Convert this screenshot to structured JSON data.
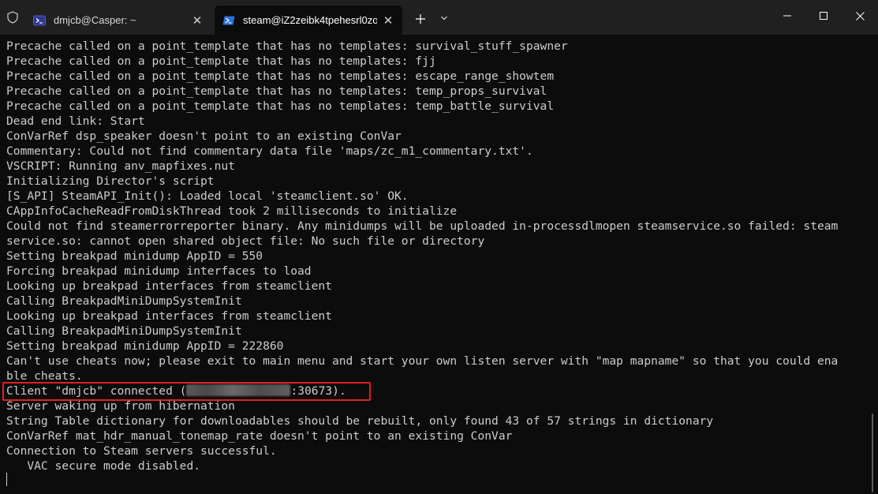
{
  "titlebar": {
    "tabs": [
      {
        "title": "dmjcb@Casper: ~",
        "close": "✕"
      },
      {
        "title": "steam@iZ2zeibk4tpehesrl0zoc",
        "close": "✕"
      }
    ],
    "new_tab": "+"
  },
  "terminal": {
    "lines": [
      "Precache called on a point_template that has no templates: survival_stuff_spawner",
      "Precache called on a point_template that has no templates: fjj",
      "Precache called on a point_template that has no templates: escape_range_showtem",
      "Precache called on a point_template that has no templates: temp_props_survival",
      "Precache called on a point_template that has no templates: temp_battle_survival",
      "Dead end link: Start",
      "ConVarRef dsp_speaker doesn't point to an existing ConVar",
      "Commentary: Could not find commentary data file 'maps/zc_m1_commentary.txt'.",
      "VSCRIPT: Running anv_mapfixes.nut",
      "Initializing Director's script",
      "[S_API] SteamAPI_Init(): Loaded local 'steamclient.so' OK.",
      "CAppInfoCacheReadFromDiskThread took 2 milliseconds to initialize",
      "Could not find steamerrorreporter binary. Any minidumps will be uploaded in-processdlmopen steamservice.so failed: steam",
      "service.so: cannot open shared object file: No such file or directory",
      "Setting breakpad minidump AppID = 550",
      "Forcing breakpad minidump interfaces to load",
      "Looking up breakpad interfaces from steamclient",
      "Calling BreakpadMiniDumpSystemInit",
      "Looking up breakpad interfaces from steamclient",
      "Calling BreakpadMiniDumpSystemInit",
      "Setting breakpad minidump AppID = 222860",
      "Can't use cheats now; please exit to main menu and start your own listen server with \"map mapname\" so that you could ena",
      "ble cheats."
    ],
    "client_line": {
      "prefix": "Client \"dmjcb\" connected (",
      "suffix": ":30673)."
    },
    "lines_after": [
      "Server waking up from hibernation",
      "String Table dictionary for downloadables should be rebuilt, only found 43 of 57 strings in dictionary",
      "ConVarRef mat_hdr_manual_tonemap_rate doesn't point to an existing ConVar",
      "Connection to Steam servers successful.",
      "   VAC secure mode disabled."
    ]
  },
  "colors": {
    "background": "#0c0c0c",
    "titlebar": "#202020",
    "text": "#cccccc",
    "highlight": "#e02020"
  }
}
